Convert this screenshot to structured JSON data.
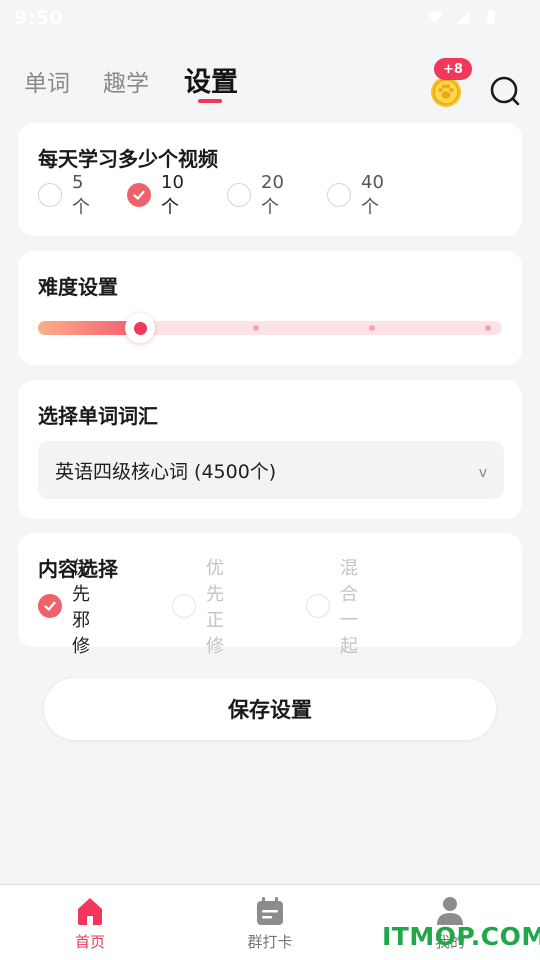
{
  "status_bar": {
    "time": "9:50"
  },
  "top_nav": {
    "tabs": [
      {
        "label": "单词",
        "active": false
      },
      {
        "label": "趣学",
        "active": false
      },
      {
        "label": "设置",
        "active": true
      }
    ],
    "coin_badge": "+8",
    "accent_color": "#f2385a"
  },
  "videos_card": {
    "title": "每天学习多少个视频",
    "options": [
      {
        "label": "5个",
        "checked": false
      },
      {
        "label": "10个",
        "checked": true
      },
      {
        "label": "20个",
        "checked": false
      },
      {
        "label": "40个",
        "checked": false
      }
    ]
  },
  "difficulty_card": {
    "title": "难度设置",
    "slider": {
      "steps": 5,
      "selected_step": 2
    }
  },
  "vocab_card": {
    "title": "选择单词词汇",
    "selected": "英语四级核心词 (4500个)",
    "chevron": "v"
  },
  "content_card": {
    "title": "内容选择",
    "options": [
      {
        "label": "优先邪修",
        "checked": true
      },
      {
        "label": "优先正修",
        "checked": false
      },
      {
        "label": "混合一起",
        "checked": false
      }
    ]
  },
  "save_button": {
    "label": "保存设置"
  },
  "bottom_nav": {
    "items": [
      {
        "label": "首页",
        "icon": "home-icon",
        "active": true
      },
      {
        "label": "群打卡",
        "icon": "calendar-icon",
        "active": false
      },
      {
        "label": "我的",
        "icon": "user-icon",
        "active": false
      }
    ]
  },
  "watermark": "ITMOP.COM"
}
